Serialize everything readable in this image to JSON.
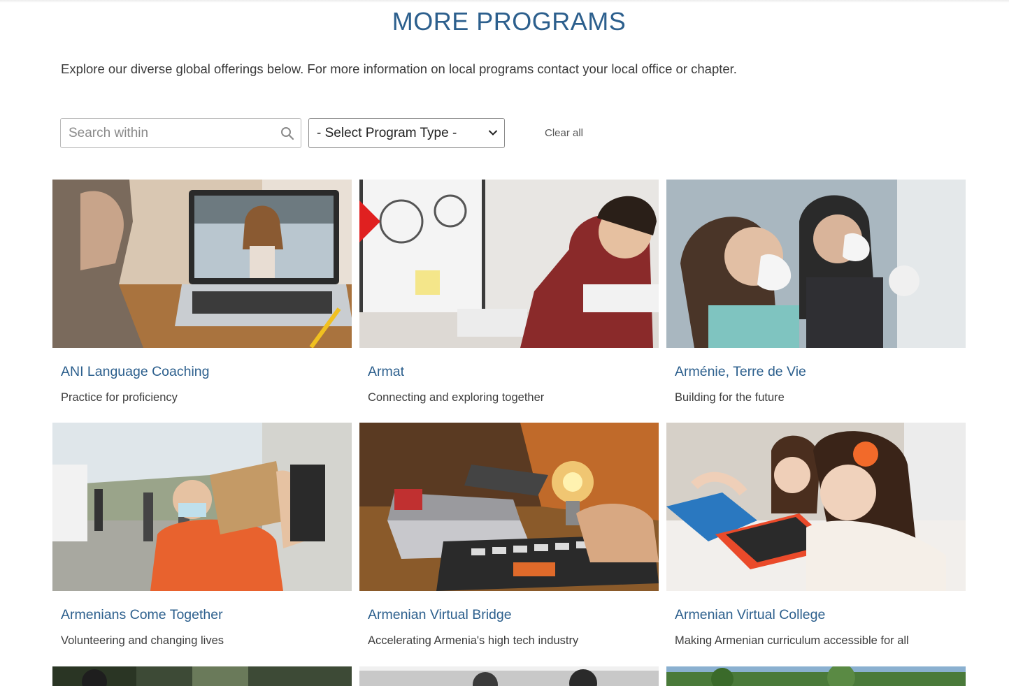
{
  "page": {
    "title": "MORE PROGRAMS",
    "intro": "Explore our diverse global offerings below. For more information on local programs contact your local office or chapter."
  },
  "filters": {
    "search_placeholder": "Search within",
    "search_icon": "search-icon",
    "select_value": "- Select Program Type -",
    "select_icon": "chevron-down-icon",
    "clear_label": "Clear all"
  },
  "programs": [
    {
      "title": "ANI Language Coaching",
      "subtitle": "Practice for proficiency",
      "image": "video-call-laptop-photo"
    },
    {
      "title": "Armat",
      "subtitle": "Connecting and exploring together",
      "image": "boy-at-computer-photo"
    },
    {
      "title": "Arménie, Terre de Vie",
      "subtitle": "Building for the future",
      "image": "volunteers-masks-photo"
    },
    {
      "title": "Armenians Come Together",
      "subtitle": "Volunteering and changing lives",
      "image": "volunteer-carrying-box-photo"
    },
    {
      "title": "Armenian Virtual Bridge",
      "subtitle": "Accelerating Armenia's high tech industry",
      "image": "lightbulb-laptop-photo"
    },
    {
      "title": "Armenian Virtual College",
      "subtitle": "Making Armenian curriculum accessible for all",
      "image": "children-with-tablet-photo"
    }
  ],
  "colors": {
    "accent": "#2c5f8d",
    "text": "#333333"
  }
}
